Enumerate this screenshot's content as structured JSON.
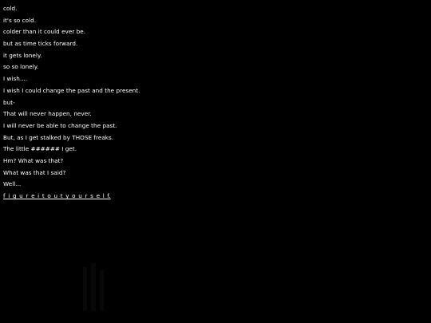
{
  "lines": [
    "cold.",
    "it's so cold.",
    "colder than it could ever be.",
    "but as time ticks forward.",
    "it gets lonely.",
    "so so lonely.",
    "I wish....",
    "I wish I could change the past and the present.",
    "but-",
    "That will never happen, never.",
    "I will never be able to change the past.",
    "But, as I get stalked by THOSE freaks.",
    "The little ###### I get.",
    "Hm? What was that?",
    "What was that I said?",
    "Well...",
    "f_i_g_u_r_e_i_t_o_u_t_y_o_u_r_s_e_l_f."
  ],
  "colors": {
    "background": "#000000",
    "text": "#ffffff"
  }
}
